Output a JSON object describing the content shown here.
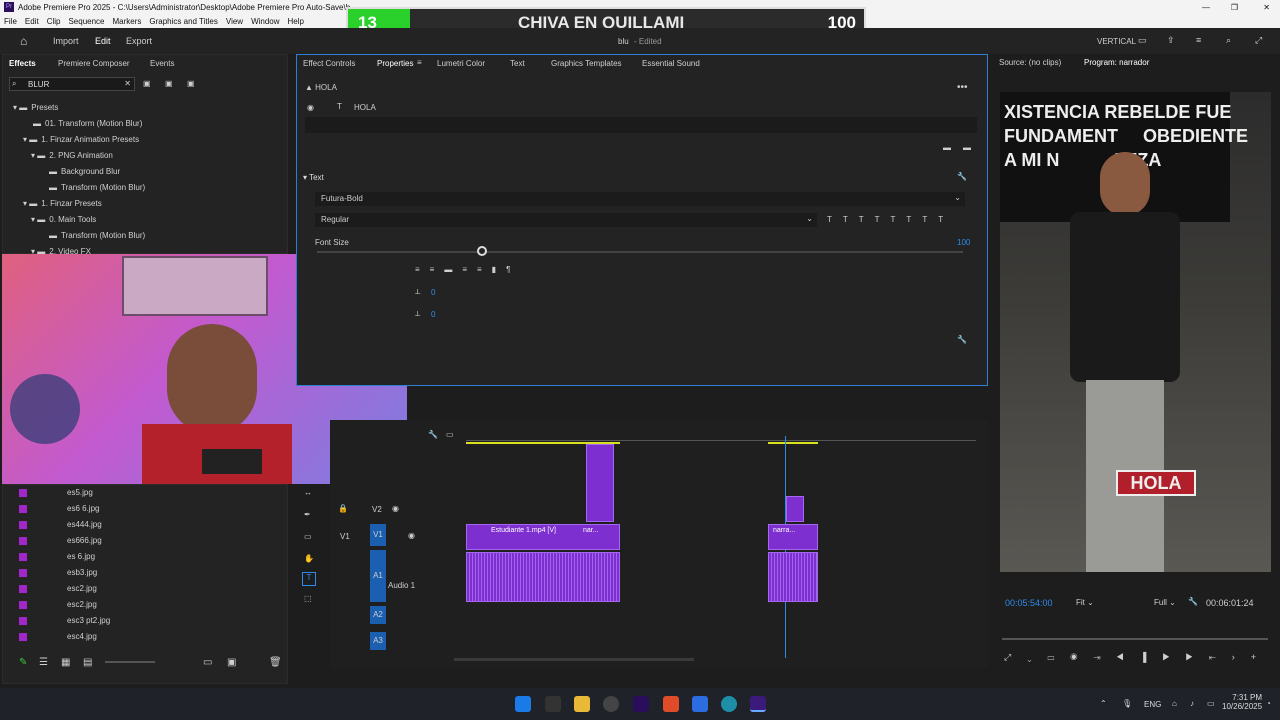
{
  "titlebar": {
    "app_title": "Adobe Premiere Pro 2025 - C:\\Users\\Administrator\\Desktop\\Adobe Premiere Pro Auto-Save\\b..."
  },
  "menu": [
    "File",
    "Edit",
    "Clip",
    "Sequence",
    "Markers",
    "Graphics and Titles",
    "View",
    "Window",
    "Help"
  ],
  "overlay": {
    "left_num": "13",
    "title": "CHIVA EN QUILLAMI",
    "right_num": "100"
  },
  "workspace": {
    "tabs": [
      "Import",
      "Edit",
      "Export"
    ],
    "active": "Edit",
    "doc_title": "blu",
    "doc_status": "- Edited",
    "layout": "VERTICAL"
  },
  "effects": {
    "tabs": [
      "Effects",
      "Premiere Composer",
      "Events"
    ],
    "search": "BLUR",
    "tree": [
      "Presets",
      "01. Transform (Motion Blur)",
      "1. Finzar Animation Presets",
      "2. PNG Animation",
      "Background Blur",
      "Transform (Motion Blur)",
      "1. Finzar Presets",
      "0. Main Tools",
      "Transform (Motion Blur)",
      "2. Video FX"
    ]
  },
  "project_files": [
    "es5.jpg",
    "es6 6.jpg",
    "es444.jpg",
    "es666.jpg",
    "es 6.jpg",
    "esb3.jpg",
    "esc2.jpg",
    "esc2.jpg",
    "esc3 pt2.jpg",
    "esc4.jpg"
  ],
  "props": {
    "tabs": [
      "Effect Controls",
      "Properties",
      "Lumetri Color",
      "Text",
      "Graphics Templates",
      "Essential Sound"
    ],
    "active": "Properties",
    "clip_name": "HOLA",
    "layer_name": "HOLA",
    "section": "Text",
    "font": "Futura-Bold",
    "style": "Regular",
    "font_size_label": "Font Size",
    "font_size": "100",
    "val1": "0",
    "val2": "0"
  },
  "source": {
    "label": "Source: (no clips)",
    "program": "Program: narrador"
  },
  "program": {
    "timecode": "00:05:54:00",
    "fit": "Fit",
    "quality": "Full",
    "duration": "00:06:01:24",
    "banner_lines": [
      "XISTENCIA REBELDE FUE",
      "FUNDAMENT     OBEDIENTE",
      "A MI N           LEZA"
    ],
    "hola": "HOLA"
  },
  "timeline": {
    "tracks": [
      "V2",
      "V1",
      "A1",
      "A2",
      "A3"
    ],
    "audio_name": "Audio 1",
    "clip1": "Estudiante 1.mp4 [V]",
    "clip2": "nar...",
    "clip3": "narra..."
  },
  "taskbar": {
    "lang": "ENG",
    "time": "7:31 PM",
    "date": "10/26/2025"
  },
  "colors": {
    "accent": "#2d8ceb",
    "clip": "#7d2fd0",
    "overlay_green": "#2ad12a"
  }
}
